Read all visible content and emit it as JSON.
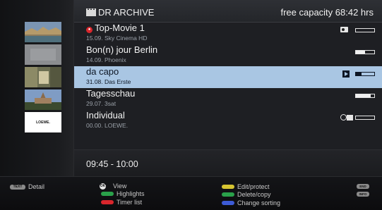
{
  "header": {
    "title": "DR ARCHIVE",
    "capacity": "free capacity 68:42 hrs"
  },
  "recordings": [
    {
      "title": "Top-Movie 1",
      "subtitle": "15.09.  Sky Cinema HD",
      "progress": 0.0,
      "icon": "key-icon",
      "recording": true
    },
    {
      "title": "Bon(n) jour Berlin",
      "subtitle": "14.09.  Phoenix",
      "progress": 0.5
    },
    {
      "title": "da capo",
      "subtitle": "31.08.  Das Erste",
      "progress": 0.3,
      "icon": "play-icon",
      "selected": true
    },
    {
      "title": "Tagesschau",
      "subtitle": "29.07.  3sat",
      "progress": 0.8
    },
    {
      "title": "Individual",
      "subtitle": "00.00.  LOEWE.",
      "progress": 0.0,
      "icon": "timer-camera-icon"
    }
  ],
  "thumbnails": [
    {
      "name": "river-city-thumbnail"
    },
    {
      "name": "grey-thumbnail",
      "label": ""
    },
    {
      "name": "street-thumbnail"
    },
    {
      "name": "church-thumbnail"
    },
    {
      "name": "loewe-logo-thumbnail",
      "label": "LOEWE."
    }
  ],
  "time_range": "09:45 - 10:00",
  "help": {
    "detail_key": "TEXT",
    "detail_label": "Detail",
    "view_key": "OK",
    "view_label": "View",
    "highlights_label": "Highlights",
    "timer_label": "Timer list",
    "edit_label": "Edit/protect",
    "delete_label": "Delete/copy",
    "sorting_label": "Change sorting",
    "end_key": "END",
    "info_key": "INFO"
  },
  "colors": {
    "selected_row": "#a9c6e3",
    "green": "#2aa14a",
    "red": "#d9262c",
    "yellow": "#d6c531",
    "blue": "#3d5bd6"
  }
}
